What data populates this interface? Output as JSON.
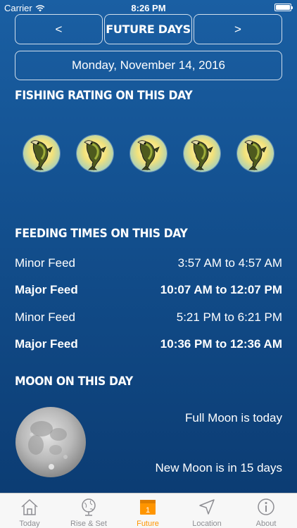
{
  "status_bar": {
    "carrier": "Carrier",
    "time": "8:26 PM",
    "battery_level": 1.0
  },
  "nav": {
    "prev_label": "<",
    "title": "FUTURE DAYS",
    "next_label": ">"
  },
  "date": "Monday, November 14, 2016",
  "rating": {
    "heading": "FISHING RATING ON THIS DAY",
    "count": 5,
    "icon": "bass-fish-icon"
  },
  "feeding": {
    "heading": "FEEDING TIMES ON THIS DAY",
    "rows": [
      {
        "label": "Minor Feed",
        "time": "3:57 AM to 4:57 AM",
        "bold": false
      },
      {
        "label": "Major Feed",
        "time": "10:07 AM to 12:07 PM",
        "bold": true
      },
      {
        "label": "Minor Feed",
        "time": "5:21 PM to 6:21 PM",
        "bold": false
      },
      {
        "label": "Major Feed",
        "time": "10:36 PM to 12:36 AM",
        "bold": true
      }
    ]
  },
  "moon": {
    "heading": "MOON ON THIS DAY",
    "full_text": "Full Moon is today",
    "new_text": "New Moon is in 15 days"
  },
  "tabs": [
    {
      "label": "Today",
      "icon": "home-icon",
      "active": false
    },
    {
      "label": "Rise & Set",
      "icon": "globe-icon",
      "active": false
    },
    {
      "label": "Future",
      "icon": "calendar-icon",
      "active": true,
      "badge": "1"
    },
    {
      "label": "Location",
      "icon": "location-arrow-icon",
      "active": false
    },
    {
      "label": "About",
      "icon": "info-icon",
      "active": false
    }
  ],
  "colors": {
    "accent": "#ff9500",
    "tab_inactive": "#8e8e93",
    "background_top": "#1a5fa3",
    "background_bottom": "#0b3a70"
  }
}
